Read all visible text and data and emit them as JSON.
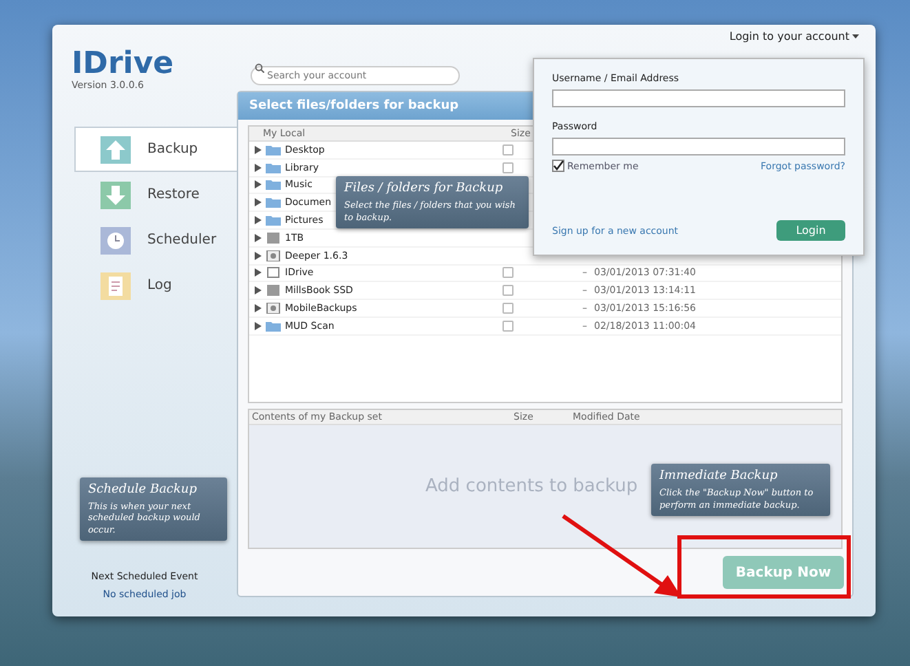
{
  "app": {
    "logo": "IDrive",
    "version": "Version 3.0.0.6",
    "search": {
      "placeholder": "Search your account"
    },
    "login_link": "Login to your account"
  },
  "nav": [
    {
      "label": "Backup",
      "kind": "backup",
      "selected": true
    },
    {
      "label": "Restore",
      "kind": "restore",
      "selected": false
    },
    {
      "label": "Scheduler",
      "kind": "scheduler",
      "selected": false
    },
    {
      "label": "Log",
      "kind": "log",
      "selected": false
    }
  ],
  "schedule_tip": {
    "title": "Schedule Backup",
    "text": "This is when your next scheduled backup would occur."
  },
  "next_event": {
    "label": "Next Scheduled Event",
    "value": "No scheduled job"
  },
  "panel_title": "Select files/folders for backup",
  "tree": {
    "columns": [
      "My Local",
      "Size"
    ],
    "rows": [
      {
        "name": "Desktop",
        "kind": "folder",
        "checked": false
      },
      {
        "name": "Library",
        "kind": "folder",
        "checked": false
      },
      {
        "name": "Music",
        "kind": "folder"
      },
      {
        "name": "Documen",
        "kind": "folder"
      },
      {
        "name": "Pictures",
        "kind": "folder"
      },
      {
        "name": "1TB",
        "kind": "drive"
      },
      {
        "name": "Deeper 1.6.3",
        "kind": "app"
      },
      {
        "name": "IDrive",
        "kind": "file",
        "checked": false,
        "size": "–",
        "date": "03/01/2013 07:31:40"
      },
      {
        "name": "MillsBook SSD",
        "kind": "drive",
        "checked": false,
        "size": "–",
        "date": "03/01/2013 13:14:11"
      },
      {
        "name": "MobileBackups",
        "kind": "app",
        "checked": false,
        "size": "–",
        "date": "03/01/2013 15:16:56"
      },
      {
        "name": "MUD Scan",
        "kind": "folder",
        "checked": false,
        "size": "–",
        "date": "02/18/2013 11:00:04"
      }
    ]
  },
  "files_tip": {
    "title": "Files / folders for Backup",
    "text": "Select the files / folders that you wish to backup."
  },
  "backup_set": {
    "columns": [
      "Contents of my Backup set",
      "Size",
      "Modified Date"
    ],
    "empty_text": "Add contents to backup"
  },
  "immediate_tip": {
    "title": "Immediate Backup",
    "text": "Click the \"Backup Now\" button to perform an immediate backup."
  },
  "backup_button": "Backup Now",
  "login": {
    "username_label": "Username / Email Address",
    "password_label": "Password",
    "remember": {
      "label": "Remember me",
      "checked": true
    },
    "forgot": "Forgot password?",
    "signup": "Sign up for a new account",
    "button": "Login"
  }
}
